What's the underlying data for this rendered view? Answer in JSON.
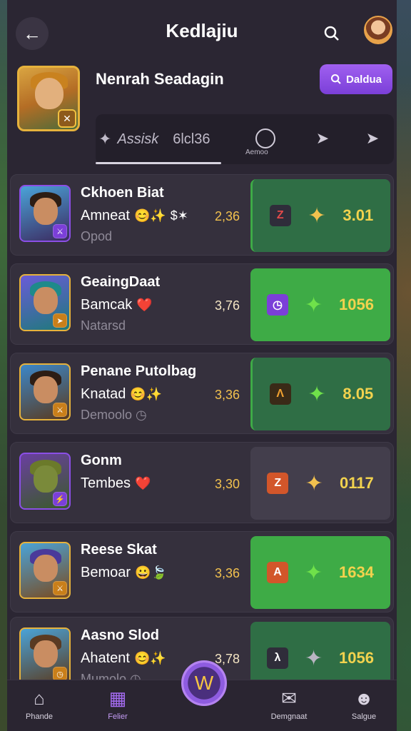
{
  "header": {
    "title": "Kedlajiu",
    "back_icon": "arrow-left-icon",
    "search_icon": "search-icon"
  },
  "profile": {
    "name": "Nenrah Seadagin",
    "pill_button_label": "Daldua",
    "tabs": {
      "main_label": "Assisk",
      "main_count": "6lcl36",
      "second_caption": "Aemoo"
    }
  },
  "players": [
    {
      "name": "Ckhoen Biat",
      "subtitle": "Amneat",
      "status": "Opod",
      "score": "2,36",
      "rank": "Z",
      "value": "3.01",
      "emoji": "😊✨",
      "extra": "$✶",
      "highlight": "#2f6e45",
      "rank_color": "#2f2d3a",
      "star": "gold",
      "badge_color": "#7b3fd8"
    },
    {
      "name": "GeaingDaat",
      "subtitle": "Bamcak",
      "status": "Natarsd",
      "score": "3,76",
      "rank": "◷",
      "value": "1056",
      "emoji": "❤️",
      "extra": "",
      "highlight": "#3eab46",
      "rank_color": "#7b3fd8",
      "star": "green",
      "badge_color": "#c97f1a"
    },
    {
      "name": "Penane Putolbag",
      "subtitle": "Knatad",
      "status": "Demoolo ◷",
      "score": "3,36",
      "rank": "Λ",
      "value": "8.05",
      "emoji": "😊✨",
      "extra": "",
      "highlight": "#2f6e45",
      "rank_color": "#3a2a17",
      "star": "green",
      "badge_color": "#c97f1a"
    },
    {
      "name": "Gonm",
      "subtitle": "Tembes",
      "status": "",
      "score": "3,30",
      "rank": "Z",
      "value": "0117",
      "emoji": "❤️",
      "extra": "",
      "highlight": "#433e4c",
      "rank_color": "#d2562a",
      "star": "gold",
      "badge_color": "#7b3fd8"
    },
    {
      "name": "Reese Skat",
      "subtitle": "Bemoar",
      "status": "",
      "score": "3,36",
      "rank": "A",
      "value": "1634",
      "emoji": "😀🍃",
      "extra": "",
      "highlight": "#3eab46",
      "rank_color": "#d2562a",
      "star": "green",
      "badge_color": "#c97f1a"
    },
    {
      "name": "Aasno Slod",
      "subtitle": "Ahatent",
      "status": "Mumolo ◷",
      "score": "3,78",
      "rank": "λ",
      "value": "1056",
      "emoji": "😊✨",
      "extra": "",
      "highlight": "#2f6e45",
      "rank_color": "#2f2d3a",
      "star": "silver",
      "badge_color": "#c97f1a"
    }
  ],
  "nav": {
    "home": "Phande",
    "active": "Felier",
    "chat": "Demgnaat",
    "profile": "Salgue"
  },
  "colors": {
    "accent": "#8b4fe6",
    "panel": "#2b2633",
    "gold": "#f2c14e"
  }
}
